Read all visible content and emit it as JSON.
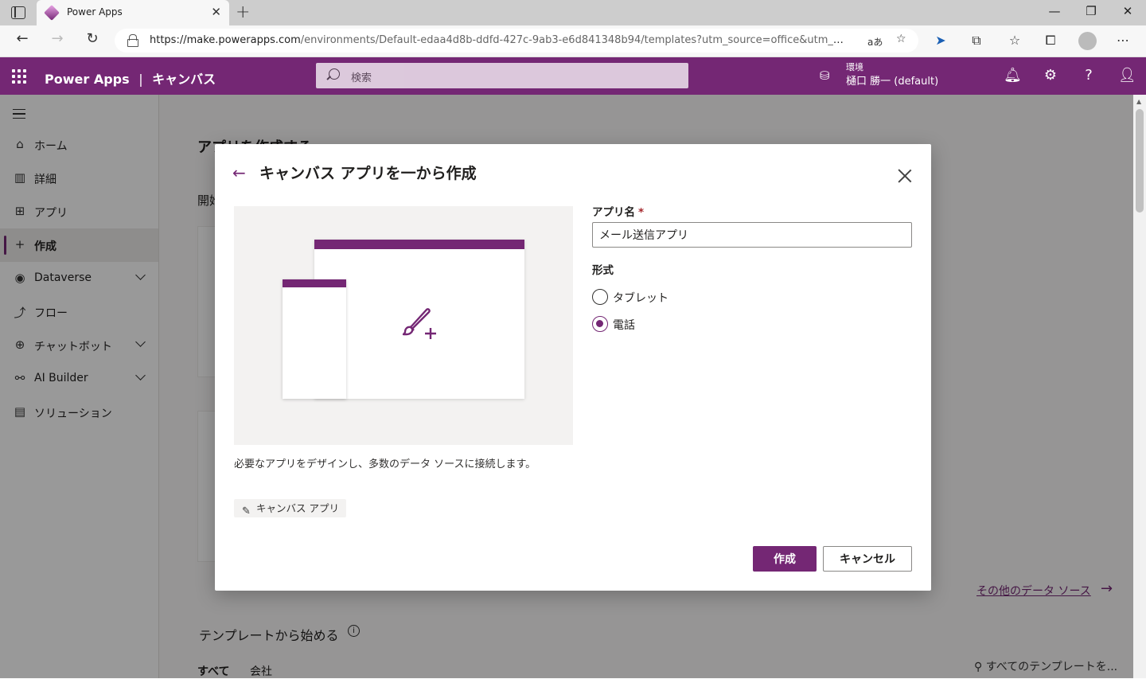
{
  "browser": {
    "tab_title": "Power Apps",
    "url_host": "https://make.powerapps.com",
    "url_path": "/environments/Default-edaa4d8b-ddfd-427c-9ab3-e6d841348b94/templates?utm_source=office&utm_medium...",
    "read_aloud": "aあ",
    "brand_color": "#742774"
  },
  "appbar": {
    "product": "Power Apps",
    "separator": "|",
    "section": "キャンバス",
    "search_placeholder": "検索",
    "env_label": "環境",
    "env_name": "樋口 勝一 (default)"
  },
  "sidebar": {
    "items": [
      {
        "label": "ホーム",
        "icon": "home-icon"
      },
      {
        "label": "詳細",
        "icon": "book-icon"
      },
      {
        "label": "アプリ",
        "icon": "apps-icon"
      },
      {
        "label": "作成",
        "icon": "plus-icon"
      },
      {
        "label": "Dataverse",
        "icon": "dataverse-icon"
      },
      {
        "label": "フロー",
        "icon": "flow-icon"
      },
      {
        "label": "チャットボット",
        "icon": "bot-icon"
      },
      {
        "label": "AI Builder",
        "icon": "ai-icon"
      },
      {
        "label": "ソリューション",
        "icon": "solution-icon"
      }
    ]
  },
  "main": {
    "title": "アプリを作成する",
    "start_label": "開始",
    "other_sources": "その他のデータ ソース",
    "templates_title": "テンプレートから始める",
    "filters": [
      "すべて",
      "会社"
    ],
    "template_search": "すべてのテンプレートを..."
  },
  "dialog": {
    "title": "キャンバス アプリを一から作成",
    "description": "必要なアプリをデザインし、多数のデータ ソースに接続します。",
    "chip": "キャンバス アプリ",
    "app_name_label": "アプリ名",
    "required_mark": "*",
    "app_name_value": "メール送信アプリ",
    "format_label": "形式",
    "options": [
      {
        "label": "タブレット",
        "selected": false
      },
      {
        "label": "電話",
        "selected": true
      }
    ],
    "create_button": "作成",
    "cancel_button": "キャンセル"
  }
}
